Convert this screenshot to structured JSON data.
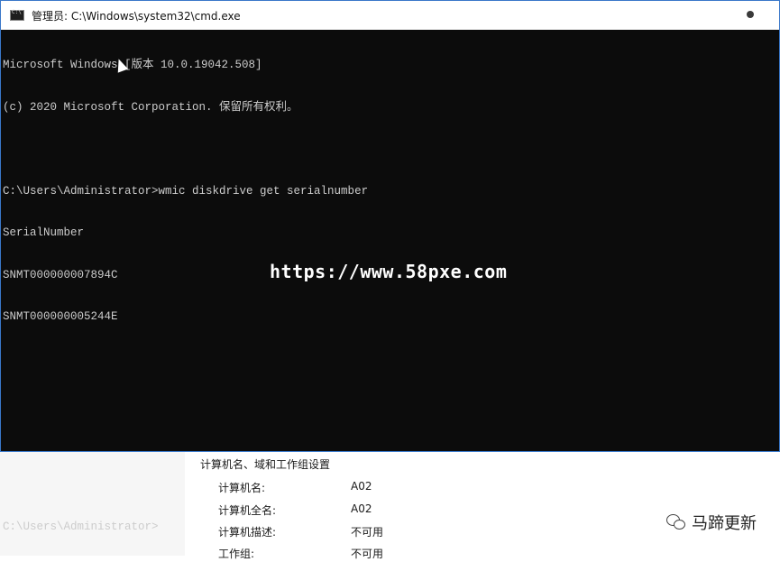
{
  "window": {
    "title": "管理员: C:\\Windows\\system32\\cmd.exe"
  },
  "console": {
    "lines": [
      "Microsoft Windows [版本 10.0.19042.508]",
      "(c) 2020 Microsoft Corporation. 保留所有权利。",
      "",
      "C:\\Users\\Administrator>wmic diskdrive get serialnumber",
      "SerialNumber",
      "SNMT000000007894C",
      "SNMT000000005244E",
      "",
      "",
      "",
      "",
      "C:\\Users\\Administrator>"
    ]
  },
  "watermark": "https://www.58pxe.com",
  "system_props": {
    "group_title": "计算机名、域和工作组设置",
    "rows": [
      {
        "label": "计算机名:",
        "value": "A02"
      },
      {
        "label": "计算机全名:",
        "value": "A02"
      },
      {
        "label": "计算机描述:",
        "value": "不可用"
      },
      {
        "label": "工作组:",
        "value": "不可用"
      }
    ]
  },
  "wechat": {
    "icon": "wechat-icon",
    "name": "马蹄更新"
  },
  "colors": {
    "console_bg": "#0c0c0c",
    "console_text": "#cccccc",
    "border": "#3a78c9"
  }
}
